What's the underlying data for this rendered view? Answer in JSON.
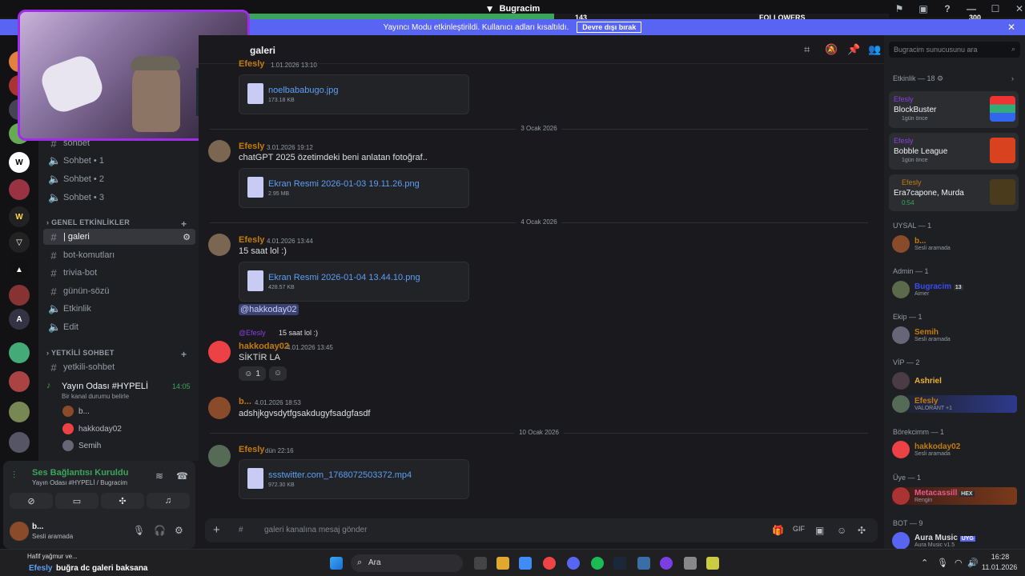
{
  "window": {
    "title": "Bugracim"
  },
  "followers": {
    "current": "143",
    "label": "FOLLOWERS",
    "goal": "300",
    "progress": 0.477
  },
  "streamer_bar": {
    "text": "Yayıncı Modu etkinleştirildi. Kullanıcı adları kısaltıldı.",
    "button": "Devre dışı bırak"
  },
  "channels": {
    "items_top": [
      {
        "label": "sohbet"
      },
      {
        "label": "Sohbet • 1"
      },
      {
        "label": "Sohbet • 2"
      },
      {
        "label": "Sohbet • 3"
      }
    ],
    "category_events": "GENEL ETKİNLİKLER",
    "items_events": [
      {
        "label": "| galeri"
      },
      {
        "label": "bot-komutları"
      },
      {
        "label": "trivia-bot"
      },
      {
        "label": "günün-sözü"
      },
      {
        "label": "Etkinlik"
      },
      {
        "label": "Edit"
      }
    ],
    "category_staff": "YETKİLİ SOHBET",
    "staff_channel": "yetkili-sohbet",
    "voice_room": {
      "name": "Yayın Odası #HYPELİ",
      "time": "14:05",
      "status": "Bir kanal durumu belirle"
    },
    "voice_members": [
      "b...",
      "hakkoday02",
      "Semih"
    ]
  },
  "voice_panel": {
    "status": "Ses Bağlantısı Kuruldu",
    "sub": "Yayın Odası #HYPELİ / Bugracim",
    "user": "b...",
    "user_status": "Sesli aramada"
  },
  "header": {
    "channel": "galeri"
  },
  "messages": {
    "top_author": "Efesly",
    "top_time": "1.01.2026 13:10",
    "file1": {
      "name": "noelbababugo.jpg",
      "size": "173.18 KB"
    },
    "day1": "3 Ocak 2026",
    "m2": {
      "author": "Efesly",
      "time": "3.01.2026 19:12",
      "text": "chatGPT 2025 özetimdeki beni anlatan fotoğraf.."
    },
    "file2": {
      "name": "Ekran Resmi 2026-01-03 19.11.26.png",
      "size": "2.95 MB"
    },
    "day2": "4 Ocak 2026",
    "m3": {
      "author": "Efesly",
      "time": "4.01.2026 13:44",
      "text": "15 saat lol :)"
    },
    "file3": {
      "name": "Ekran Resmi 2026-01-04 13.44.10.png",
      "size": "428.57 KB"
    },
    "mention": "@hakkoday02",
    "reply": {
      "author": "@Efesly",
      "text": "15 saat lol :)"
    },
    "m4": {
      "author": "hakkoday02",
      "time": "4.01.2026 13:45",
      "text": "SİKTİR LA",
      "reaction_count": "1"
    },
    "m5": {
      "author": "b...",
      "time": "4.01.2026 18:53",
      "text": "adshjkgvsdytfgsakdugyfsadgfasdf"
    },
    "day3": "10 Ocak 2026",
    "m6": {
      "author": "Efesly",
      "time": "dün 22:16"
    },
    "file4": {
      "name": "ssstwitter.com_1768072503372.mp4",
      "size": "972.30 KB"
    }
  },
  "composer": {
    "placeholder": "galeri kanalına mesaj gönder"
  },
  "search": {
    "placeholder": "Bugracim sunucusunu ara"
  },
  "activity": {
    "title": "Etkinlik — 18",
    "cards": [
      {
        "user": "Efesly",
        "game": "BlockBuster",
        "sub": "1gün önce"
      },
      {
        "user": "Efesly",
        "game": "Bobble League",
        "sub": "1gün önce"
      },
      {
        "user": "Efesly",
        "game": "Era7capone, Murda",
        "sub": "0:54"
      }
    ]
  },
  "members": {
    "s1": "UYSAL — 1",
    "u1": {
      "name": "b...",
      "status": "Sesli aramada"
    },
    "s2": "Admin — 1",
    "u2": {
      "name": "Bugracim",
      "status": "Aimer",
      "badge": "13"
    },
    "s3": "Ekip — 1",
    "u3": {
      "name": "Semih",
      "status": "Sesli aramada"
    },
    "s4": "VİP — 2",
    "u4": {
      "name": "Ashriel"
    },
    "u5": {
      "name": "Efesly",
      "status": "VALORANT +1"
    },
    "s5": "Börekcimm — 1",
    "u6": {
      "name": "hakkoday02",
      "status": "Sesli aramada"
    },
    "s6": "Üye — 1",
    "u7": {
      "name": "Metacassill",
      "status": "Rengin",
      "badge": "HEX"
    },
    "s7": "BOT — 9",
    "u8": {
      "name": "Aura Music",
      "status": "Aura Music v1.5",
      "badge": "UYG"
    }
  },
  "ticker": {
    "line1": "Hafif yağmur ve...",
    "author": "Efesly",
    "text": "buğra dc galeri baksana"
  },
  "taskbar": {
    "search": "Ara",
    "time": "16:28",
    "date": "11.01.2026"
  },
  "colors": {
    "accent": "#5865f2",
    "efesly": "#c27c0e",
    "purple": "#8b3fe3",
    "link": "#5d9ff5",
    "green": "#3ba55c"
  }
}
